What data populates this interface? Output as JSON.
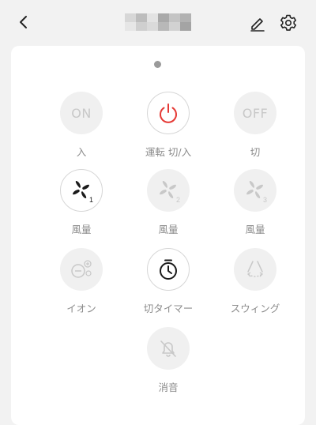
{
  "header": {
    "title_obscured": true,
    "icons": [
      "back-icon",
      "edit-icon",
      "settings-icon"
    ]
  },
  "controls": [
    {
      "name": "on",
      "face_text": "ON",
      "label": "入",
      "state": "disabled"
    },
    {
      "name": "power-toggle",
      "icon": "power-icon",
      "label": "運転 切/入",
      "state": "active",
      "accent": "#e53935"
    },
    {
      "name": "off",
      "face_text": "OFF",
      "label": "切",
      "state": "disabled"
    },
    {
      "name": "fan-speed-1",
      "icon": "fan-icon",
      "sub": "1",
      "label": "風量",
      "state": "active"
    },
    {
      "name": "fan-speed-2",
      "icon": "fan-icon",
      "sub": "2",
      "label": "風量",
      "state": "disabled"
    },
    {
      "name": "fan-speed-3",
      "icon": "fan-icon",
      "sub": "3",
      "label": "風量",
      "state": "disabled"
    },
    {
      "name": "ion",
      "icon": "ion-icon",
      "label": "イオン",
      "state": "disabled"
    },
    {
      "name": "off-timer",
      "icon": "timer-icon",
      "label": "切タイマー",
      "state": "active"
    },
    {
      "name": "swing",
      "icon": "swing-icon",
      "label": "スウィング",
      "state": "disabled"
    },
    {
      "name": "mute",
      "icon": "mute-icon",
      "label": "消音",
      "state": "disabled"
    }
  ],
  "colors": {
    "accent_power": "#e53935",
    "active_icon": "#1a1a1a",
    "disabled_icon": "#c8c8c8",
    "label": "#8c8c8c"
  }
}
